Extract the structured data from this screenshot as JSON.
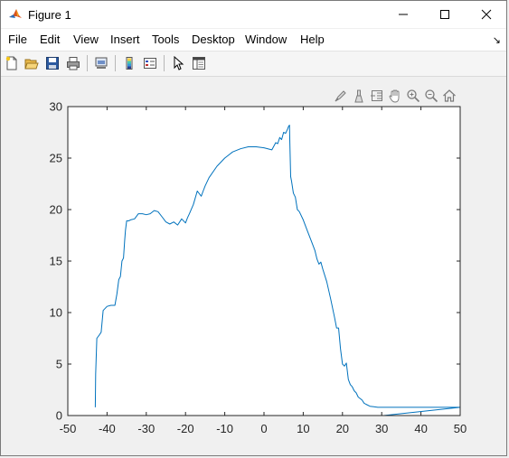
{
  "window": {
    "title": "Figure 1",
    "icons": [
      "matlab-app-icon",
      "minimize-icon",
      "maximize-icon",
      "close-icon"
    ]
  },
  "menubar": {
    "items": [
      "File",
      "Edit",
      "View",
      "Insert",
      "Tools",
      "Desktop",
      "Window",
      "Help"
    ]
  },
  "toolbar": {
    "icons": [
      "new-figure-icon",
      "open-file-icon",
      "save-icon",
      "print-icon",
      "link-plot-icon",
      "colorbar-icon",
      "legend-icon",
      "edit-plot-arrow-icon",
      "property-inspector-icon"
    ]
  },
  "axes_toolbar": {
    "icons": [
      "brush-icon",
      "data-tips-icon",
      "datatip-cursor-icon",
      "pan-hand-icon",
      "zoom-in-icon",
      "zoom-out-icon",
      "home-restore-icon"
    ]
  },
  "colors": {
    "line": "#0072bd",
    "figure_bg": "#f0f0f0",
    "axes_bg": "#ffffff"
  },
  "chart_data": {
    "type": "line",
    "title": "",
    "xlabel": "",
    "ylabel": "",
    "xlim": [
      -50,
      50
    ],
    "ylim": [
      0,
      30
    ],
    "xticks": [
      -50,
      -40,
      -30,
      -20,
      -10,
      0,
      10,
      20,
      30,
      40,
      50
    ],
    "yticks": [
      0,
      5,
      10,
      15,
      20,
      25,
      30
    ],
    "xtick_labels": [
      "-50",
      "-40",
      "-30",
      "-20",
      "-10",
      "0",
      "10",
      "20",
      "30",
      "40",
      "50"
    ],
    "ytick_labels": [
      "0",
      "5",
      "10",
      "15",
      "20",
      "25",
      "30"
    ],
    "grid": false,
    "series": [
      {
        "x": [
          -43.0,
          -42.9,
          -42.6,
          -42.0,
          -41.5,
          -41.0,
          -40.0,
          -39.0,
          -38.0,
          -37.5,
          -37.0,
          -36.6,
          -36.2,
          -35.8,
          -35.5,
          -35.3,
          -35.0,
          -34.5,
          -34.0,
          -33.0,
          -32.0,
          -31.0,
          -30.0,
          -29.0,
          -28.0,
          -27.0,
          -26.0,
          -25.0,
          -24.0,
          -23.0,
          -22.0,
          -21.0,
          -20.0,
          -19.5,
          -19.0,
          -18.0,
          -17.0,
          -16.0,
          -15.5,
          -15.0,
          -14.0,
          -12.0,
          -10.0,
          -8.0,
          -6.0,
          -4.0,
          -2.0,
          0.0,
          2.0,
          3.0,
          3.5,
          4.0,
          4.5,
          5.0,
          5.5,
          6.0,
          6.3,
          6.5,
          6.6,
          6.8,
          7.0,
          7.5,
          8.0,
          8.5,
          9.0,
          10.0,
          11.0,
          12.0,
          12.5,
          13.0,
          13.5,
          14.0,
          14.5,
          15.0,
          16.0,
          17.0,
          18.0,
          18.5,
          19.0,
          19.5,
          20.0,
          20.5,
          21.0,
          21.5,
          22.0,
          22.5,
          23.0,
          23.5,
          24.0,
          25.0,
          25.5,
          26.0,
          27.0,
          28.0,
          29.0,
          30.0,
          40.0,
          50.0,
          30.5
        ],
        "y": [
          0.8,
          4.0,
          7.5,
          7.8,
          8.1,
          10.2,
          10.6,
          10.7,
          10.7,
          11.8,
          13.2,
          13.5,
          15.0,
          15.3,
          17.0,
          18.0,
          18.9,
          18.9,
          19.0,
          19.1,
          19.6,
          19.6,
          19.5,
          19.6,
          19.9,
          19.8,
          19.3,
          18.8,
          18.6,
          18.8,
          18.5,
          19.1,
          18.7,
          19.2,
          19.6,
          20.5,
          21.8,
          21.3,
          21.8,
          22.3,
          23.1,
          24.2,
          25.0,
          25.6,
          25.9,
          26.1,
          26.1,
          26.0,
          25.8,
          26.5,
          26.4,
          27.0,
          26.8,
          27.5,
          27.4,
          27.8,
          28.1,
          28.2,
          26.5,
          23.2,
          22.8,
          21.6,
          21.2,
          20.0,
          19.8,
          19.0,
          18.0,
          17.0,
          16.5,
          16.0,
          15.2,
          14.7,
          14.9,
          14.2,
          13.0,
          11.3,
          9.5,
          8.5,
          8.5,
          6.5,
          5.0,
          4.8,
          5.1,
          3.5,
          3.0,
          2.8,
          2.4,
          2.2,
          1.8,
          1.5,
          1.2,
          1.1,
          0.9,
          0.85,
          0.8,
          0.8,
          0.8,
          0.8,
          0.0
        ]
      }
    ]
  }
}
